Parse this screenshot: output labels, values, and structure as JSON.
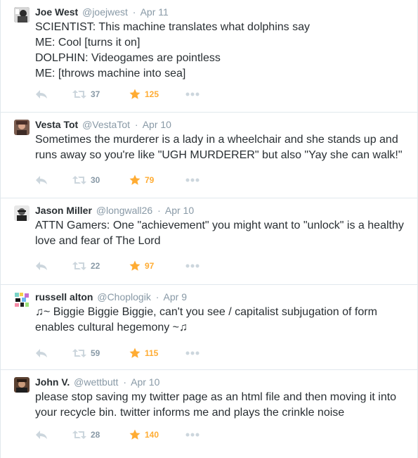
{
  "colors": {
    "text": "#292f33",
    "muted": "#8899a6",
    "star": "#ffac33",
    "divider": "#e1e8ed"
  },
  "tweets": [
    {
      "name": "Joe West",
      "handle": "@joejwest",
      "dot": "·",
      "time": "Apr 11",
      "text": "SCIENTIST: This machine translates what dolphins say\nME: Cool [turns it on]\nDOLPHIN: Videogames are pointless\nME: [throws machine into sea]",
      "retweets": "37",
      "favorites": "125"
    },
    {
      "name": "Vesta Tot",
      "handle": "@VestaTot",
      "dot": "·",
      "time": "Apr 10",
      "text": "Sometimes the murderer is a lady in a wheelchair and she stands up and runs away so you're like \"UGH MURDERER\" but also \"Yay she can walk!\"",
      "retweets": "30",
      "favorites": "79"
    },
    {
      "name": "Jason Miller",
      "handle": "@longwall26",
      "dot": "·",
      "time": "Apr 10",
      "text": "ATTN Gamers: One \"achievement\" you might want to \"unlock\" is a healthy love and fear of The Lord",
      "retweets": "22",
      "favorites": "97"
    },
    {
      "name": "russell alton",
      "handle": "@Choplogik",
      "dot": "·",
      "time": "Apr 9",
      "text": "♫~ Biggie Biggie Biggie, can't you see / capitalist subjugation of form enables cultural hegemony ~♫",
      "retweets": "59",
      "favorites": "115"
    },
    {
      "name": "John V.",
      "handle": "@wettbutt",
      "dot": "·",
      "time": "Apr 10",
      "text": "please stop saving my twitter page as an html file and then moving it into your recycle bin. twitter informs me and plays the crinkle noise",
      "retweets": "28",
      "favorites": "140"
    }
  ]
}
